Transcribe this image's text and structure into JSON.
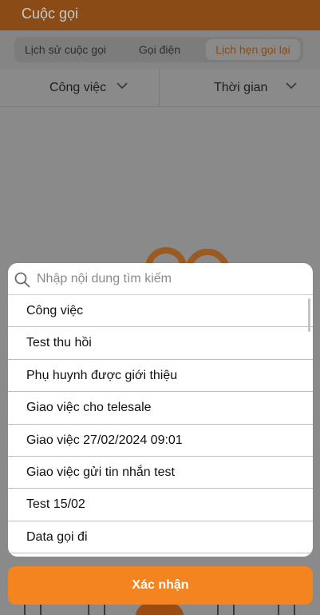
{
  "header": {
    "title": "Cuộc gọi"
  },
  "tabs": [
    {
      "label": "Lịch sử cuộc gọi"
    },
    {
      "label": "Gọi điện"
    },
    {
      "label": "Lịch hẹn gọi lại"
    }
  ],
  "filters": {
    "work_label": "Công việc",
    "time_label": "Thời gian"
  },
  "dropdown": {
    "search_placeholder": "Nhập nội dung tìm kiếm",
    "items": [
      "Công việc",
      "Test thu hồi",
      "Phụ huynh được giới thiệu",
      "Giao việc cho telesale",
      "Giao việc 27/02/2024 09:01",
      "Giao việc gửi tin nhắn test",
      "Test 15/02",
      "Data gọi đi"
    ]
  },
  "confirm_button": {
    "label": "Xác nhận"
  },
  "colors": {
    "accent": "#f4841f",
    "overlay": "#8a8a8a",
    "header_dimmed": "#8a4b16"
  }
}
